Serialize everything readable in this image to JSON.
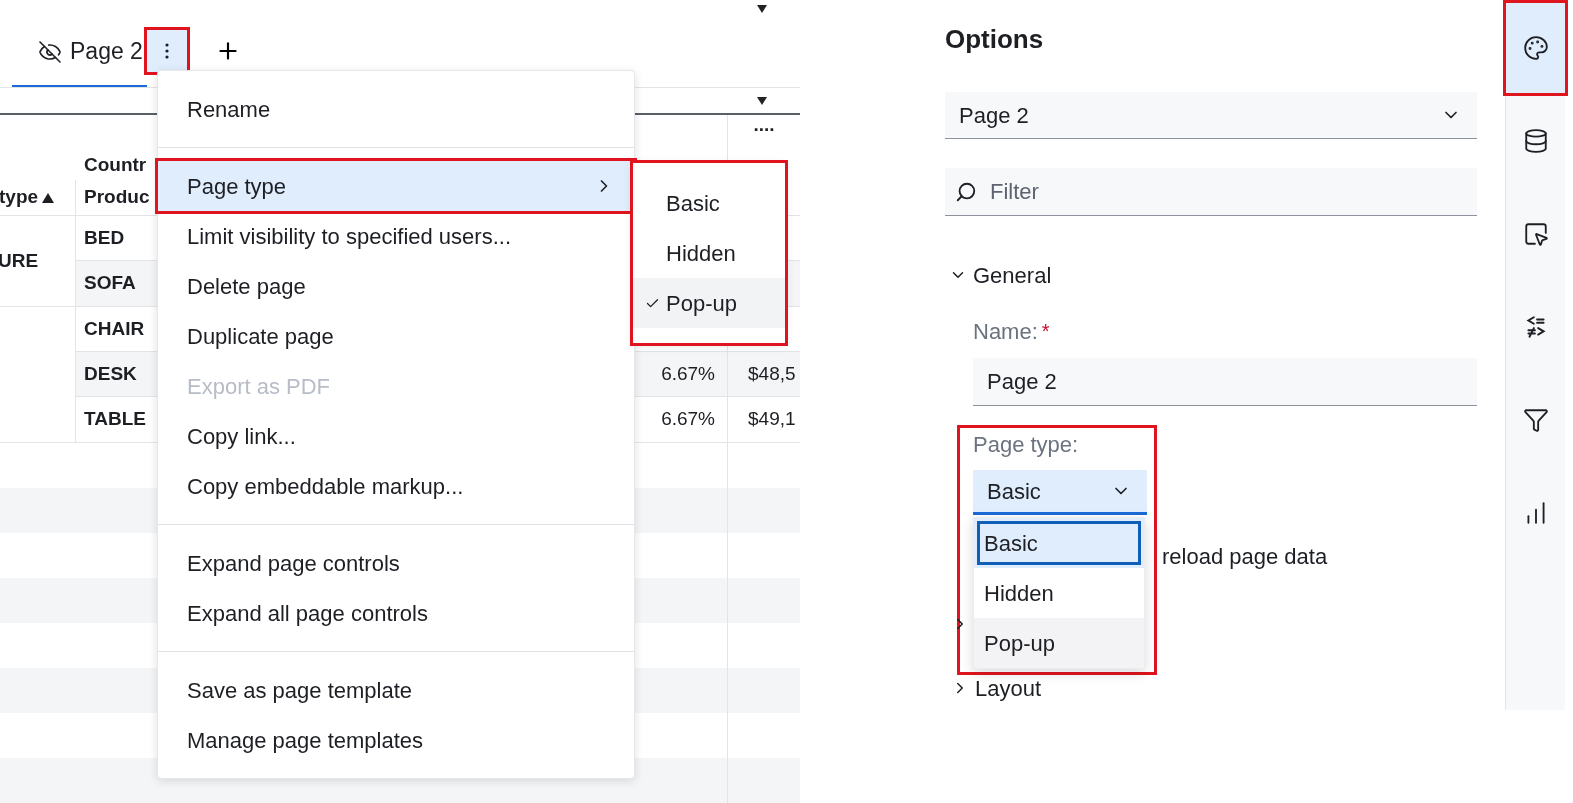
{
  "tab_bar": {
    "tabs": [
      {
        "label": "Page 2",
        "selected": true
      }
    ],
    "menu_button": {
      "highlighted": true
    }
  },
  "table": {
    "group_header": "Countr",
    "sort_column": "type",
    "product_column": "Produc",
    "column_4_header": "....",
    "groups": [
      {
        "label": "URE",
        "rows": [
          {
            "product": "BED"
          },
          {
            "product": "SOFA"
          }
        ]
      },
      {
        "rows": [
          {
            "product": "CHAIR"
          },
          {
            "product": "DESK",
            "column_3": "6.67%",
            "column_4": "$48,5"
          },
          {
            "product": "TABLE",
            "column_3": "6.67%",
            "column_4": "$49,1"
          }
        ]
      }
    ]
  },
  "context_menu": {
    "sections": [
      [
        {
          "label": "Rename",
          "disabled": false,
          "selected": false,
          "submenu": false,
          "highlighted": false
        }
      ],
      [
        {
          "label": "Page type",
          "disabled": false,
          "selected": true,
          "submenu": true,
          "highlighted": true
        },
        {
          "label": "Limit visibility to specified users...",
          "disabled": false,
          "selected": false,
          "submenu": false,
          "highlighted": false
        },
        {
          "label": "Delete page",
          "disabled": false,
          "selected": false,
          "submenu": false,
          "highlighted": false
        },
        {
          "label": "Duplicate page",
          "disabled": false,
          "selected": false,
          "submenu": false,
          "highlighted": false
        },
        {
          "label": "Export as PDF",
          "disabled": true,
          "selected": false,
          "submenu": false,
          "highlighted": false
        },
        {
          "label": "Copy link...",
          "disabled": false,
          "selected": false,
          "submenu": false,
          "highlighted": false
        },
        {
          "label": "Copy embeddable markup...",
          "disabled": false,
          "selected": false,
          "submenu": false,
          "highlighted": false
        }
      ],
      [
        {
          "label": "Expand page controls",
          "disabled": false,
          "selected": false,
          "submenu": false,
          "highlighted": false
        },
        {
          "label": "Expand all page controls",
          "disabled": false,
          "selected": false,
          "submenu": false,
          "highlighted": false
        }
      ],
      [
        {
          "label": "Save as page template",
          "disabled": false,
          "selected": false,
          "submenu": false,
          "highlighted": false
        },
        {
          "label": "Manage page templates",
          "disabled": false,
          "selected": false,
          "submenu": false,
          "highlighted": false
        }
      ]
    ]
  },
  "submenu": {
    "highlighted": true,
    "items": [
      {
        "label": "Basic",
        "checked": false
      },
      {
        "label": "Hidden",
        "checked": false
      },
      {
        "label": "Pop-up",
        "checked": true
      }
    ]
  },
  "options": {
    "title": "Options",
    "page_select": "Page 2",
    "filter_placeholder": "Filter",
    "general": {
      "label": "General",
      "expanded": true
    },
    "name_label": "Name:",
    "required_mark": "*",
    "name_value": "Page 2",
    "page_type": {
      "label": "Page type:",
      "value": "Basic",
      "highlighted": true,
      "options": [
        {
          "label": "Basic",
          "selected": true
        },
        {
          "label": "Hidden",
          "selected": false
        },
        {
          "label": "Pop-up",
          "selected": false
        }
      ]
    },
    "reload_text": "reload page data",
    "collapsed_sections": [
      {
        "expanded": false
      },
      {
        "label": "Layout",
        "expanded": false
      }
    ]
  },
  "rail": [
    {
      "kind": "palette",
      "selected": true,
      "highlighted": true
    },
    {
      "kind": "data",
      "selected": false,
      "highlighted": false
    },
    {
      "kind": "select",
      "selected": false,
      "highlighted": false
    },
    {
      "kind": "compare",
      "selected": false,
      "highlighted": false
    },
    {
      "kind": "filter",
      "selected": false,
      "highlighted": false
    },
    {
      "kind": "chart",
      "selected": false,
      "highlighted": false
    }
  ]
}
